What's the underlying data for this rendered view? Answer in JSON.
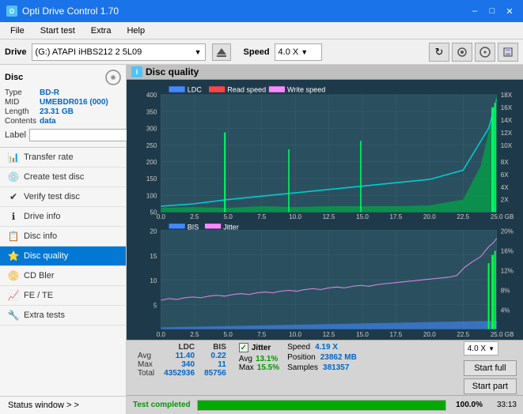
{
  "titleBar": {
    "title": "Opti Drive Control 1.70",
    "minBtn": "–",
    "maxBtn": "□",
    "closeBtn": "✕"
  },
  "menuBar": {
    "items": [
      "File",
      "Start test",
      "Extra",
      "Help"
    ]
  },
  "driveBar": {
    "label": "Drive",
    "driveText": "(G:)  ATAPI iHBS212  2 5L09",
    "speedLabel": "Speed",
    "speedValue": "4.0 X",
    "speedArrow": "▼"
  },
  "disc": {
    "title": "Disc",
    "type_label": "Type",
    "type_value": "BD-R",
    "mid_label": "MID",
    "mid_value": "UMEBDR016 (000)",
    "length_label": "Length",
    "length_value": "23.31 GB",
    "contents_label": "Contents",
    "contents_value": "data",
    "label_label": "Label"
  },
  "nav": {
    "items": [
      {
        "id": "transfer-rate",
        "label": "Transfer rate",
        "icon": "📊"
      },
      {
        "id": "create-test-disc",
        "label": "Create test disc",
        "icon": "💿"
      },
      {
        "id": "verify-test-disc",
        "label": "Verify test disc",
        "icon": "✔"
      },
      {
        "id": "drive-info",
        "label": "Drive info",
        "icon": "ℹ"
      },
      {
        "id": "disc-info",
        "label": "Disc info",
        "icon": "📋"
      },
      {
        "id": "disc-quality",
        "label": "Disc quality",
        "icon": "⭐",
        "active": true
      },
      {
        "id": "cd-bler",
        "label": "CD Bler",
        "icon": "📀"
      },
      {
        "id": "fe-te",
        "label": "FE / TE",
        "icon": "📈"
      },
      {
        "id": "extra-tests",
        "label": "Extra tests",
        "icon": "🔧"
      }
    ]
  },
  "statusWindow": {
    "label": "Status window > >"
  },
  "discQuality": {
    "title": "Disc quality"
  },
  "chart": {
    "topLegend": [
      "LDC",
      "Read speed",
      "Write speed"
    ],
    "topYMax": 400,
    "topYLabels": [
      "400",
      "350",
      "300",
      "250",
      "200",
      "150",
      "100",
      "50"
    ],
    "topY2Labels": [
      "18X",
      "16X",
      "14X",
      "12X",
      "10X",
      "8X",
      "6X",
      "4X",
      "2X"
    ],
    "xLabels": [
      "0.0",
      "2.5",
      "5.0",
      "7.5",
      "10.0",
      "12.5",
      "15.0",
      "17.5",
      "20.0",
      "22.5",
      "25.0"
    ],
    "xUnit": "GB",
    "bottomLegend": [
      "BIS",
      "Jitter"
    ],
    "bottomYMax": 20,
    "bottomYLabels": [
      "20",
      "15",
      "10",
      "5"
    ],
    "bottomY2Labels": [
      "20%",
      "16%",
      "12%",
      "8%",
      "4%"
    ]
  },
  "stats": {
    "col_ldc": "LDC",
    "col_bis": "BIS",
    "row_avg": "Avg",
    "row_max": "Max",
    "row_total": "Total",
    "ldc_avg": "11.40",
    "ldc_max": "340",
    "ldc_total": "4352936",
    "bis_avg": "0.22",
    "bis_max": "11",
    "bis_total": "85756",
    "jitter_label": "Jitter",
    "jitter_avg": "13.1%",
    "jitter_max": "15.5%",
    "speed_label": "Speed",
    "speed_value": "4.19 X",
    "position_label": "Position",
    "position_value": "23862 MB",
    "samples_label": "Samples",
    "samples_value": "381357",
    "speed_select": "4.0 X",
    "btn_start_full": "Start full",
    "btn_start_part": "Start part"
  },
  "progress": {
    "label": "Test completed",
    "percent": "100.0%",
    "time": "33:13"
  }
}
